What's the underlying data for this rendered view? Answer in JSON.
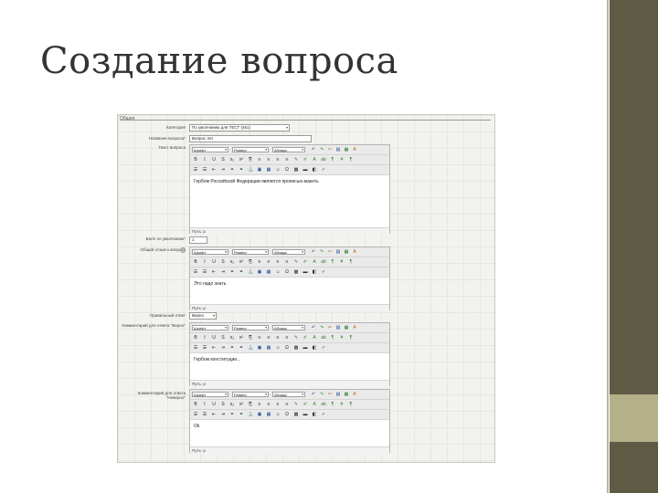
{
  "slide": {
    "title": "Создание вопроса"
  },
  "form": {
    "legend": "Общее",
    "category": {
      "label": "Категория",
      "value": "По умолчанию для ТЕСТ (461)"
    },
    "question_name": {
      "label": "Название вопроса",
      "value": "Вопрос лет"
    },
    "question_text_label": "Текст вопроса",
    "default_grade": {
      "label": "Балл по умолчанию",
      "value": "1"
    },
    "general_feedback_label": "Общий отзыв к вопросу",
    "correct_answer": {
      "label": "Правильный ответ",
      "value": "Верно"
    },
    "feedback_true_label": "Комментарий для ответа \"Верно\"",
    "feedback_false_label": "Комментарий для ответа \"Неверно\"",
    "required_mark": "*",
    "help_glyph": "?"
  },
  "editor": {
    "font_select": "Шрифт",
    "size_select": "Размер",
    "format_select": "Абзацы",
    "path_label": "Путь: p",
    "dropdown_arrow": "▾",
    "row1_icons": [
      "↶",
      "↷",
      "✂",
      "▤",
      "▦",
      "A"
    ],
    "row2_icons": [
      "B",
      "I",
      "U",
      "S",
      "x₂",
      "x²",
      "⎘",
      "≡",
      "≡",
      "≡",
      "≡",
      "✎",
      "✐",
      "A",
      "ab",
      "¶",
      "ǂ",
      "¶"
    ],
    "row3_icons": [
      "☰",
      "☰",
      "⇤",
      "⇥",
      "⚭",
      "⚭",
      "⚓",
      "▣",
      "▦",
      "☺",
      "Ω",
      "▩",
      "▬",
      "◧",
      "✓"
    ]
  },
  "editors": [
    {
      "content": "Гербом Российской Федерации является прописью-макеть"
    },
    {
      "content": "Это надо знать"
    },
    {
      "content": "Гербом конституции..."
    },
    {
      "content": "Ok"
    }
  ]
}
